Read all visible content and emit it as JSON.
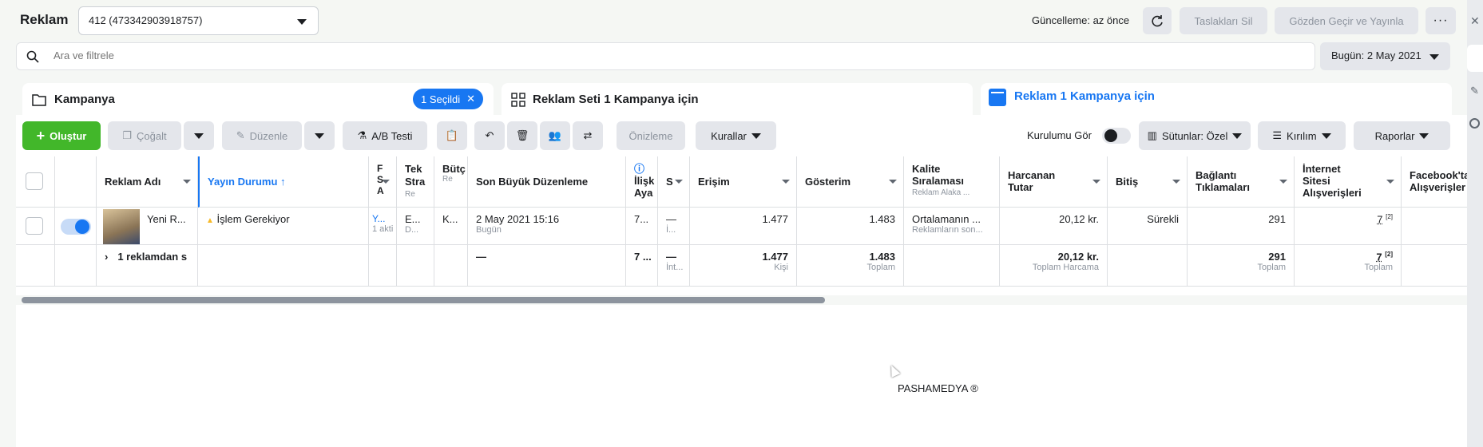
{
  "header": {
    "title": "Reklam",
    "account": "412 (473342903918757)",
    "update_status": "Güncelleme: az önce",
    "clear_drafts": "Taslakları Sil",
    "review_publish": "Gözden Geçir ve Yayınla"
  },
  "search": {
    "placeholder": "Ara ve filtrele"
  },
  "date": {
    "label": "Bugün: 2 May 2021"
  },
  "tabs": {
    "campaign": "Kampanya",
    "selected": "1 Seçildi",
    "adset": "Reklam Seti 1 Kampanya için",
    "ad": "Reklam 1 Kampanya için"
  },
  "toolbar": {
    "create": "Oluştur",
    "duplicate": "Çoğalt",
    "edit": "Düzenle",
    "ab_test": "A/B Testi",
    "preview": "Önizleme",
    "rules": "Kurallar",
    "view_setup": "Kurulumu Gör",
    "columns": "Sütunlar: Özel",
    "breakdown": "Kırılım",
    "reports": "Raporlar"
  },
  "table": {
    "headers": {
      "ad_name": "Reklam Adı",
      "delivery": "Yayın Durumu ↑",
      "c1": "F",
      "c1b": "S",
      "c1c": "A",
      "strategy": "Tek",
      "strategy_b": "Stra",
      "strategy_sub": "Re",
      "budget": "Bütç",
      "budget_sub": "Re",
      "last_edit": "Son Büyük Düzenleme",
      "attr": "İlişk",
      "attr_b": "Aya",
      "s2": "S",
      "reach": "Erişim",
      "impressions": "Gösterim",
      "quality": "Kalite",
      "quality_b": "Sıralaması",
      "quality_sub": "Reklam Alaka ...",
      "spent": "Harcanan",
      "spent_b": "Tutar",
      "ends": "Bitiş",
      "link_clicks": "Bağlantı",
      "link_clicks_b": "Tıklamaları",
      "web_purchases": "İnternet",
      "web_purchases_b": "Sitesi",
      "web_purchases_c": "Alışverişleri",
      "fb_purchases": "Facebook'tak",
      "fb_purchases_b": "Alışverişler"
    },
    "row": {
      "name": "Yeni R...",
      "delivery": "İşlem Gerekiyor",
      "c1": "Y...",
      "c1_sub": "1 akti",
      "strategy": "E...",
      "strategy_sub": "D...",
      "budget": "K...",
      "last_edit": "2 May 2021 15:16",
      "last_edit_sub": "Bugün",
      "attr": "7...",
      "s2": "—",
      "s2_sub": "İ...",
      "reach": "1.477",
      "impressions": "1.483",
      "quality": "Ortalamanın ...",
      "quality_sub": "Reklamların son...",
      "spent": "20,12 kr.",
      "ends": "Sürekli",
      "link_clicks": "291",
      "web_purchases": "7",
      "web_purchases_note": "[2]"
    },
    "summary": {
      "label": "1 reklamdan s",
      "last_edit": "—",
      "attr": "7 ...",
      "s2": "—",
      "s2_sub": "İnt...",
      "reach": "1.477",
      "reach_sub": "Kişi",
      "impressions": "1.483",
      "impressions_sub": "Toplam",
      "spent": "20,12 kr.",
      "spent_sub": "Toplam Harcama",
      "link_clicks": "291",
      "link_clicks_sub": "Toplam",
      "web_purchases": "7",
      "web_purchases_note": "[2]",
      "web_purchases_sub": "Toplam"
    }
  },
  "watermark": "PASHAMEDYA ®",
  "colors": {
    "accent": "#1877f2",
    "create": "#42b72a",
    "warning": "#f7b928"
  }
}
